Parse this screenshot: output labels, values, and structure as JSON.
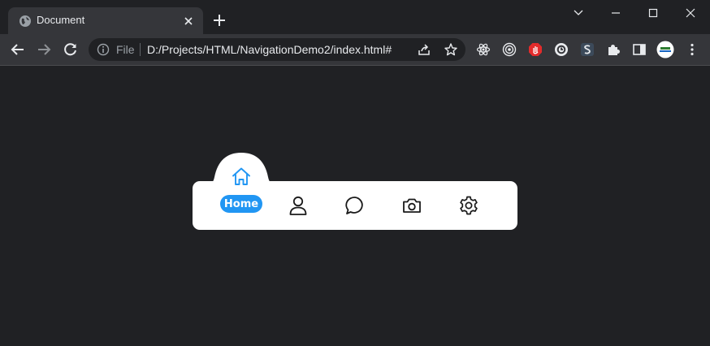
{
  "browser": {
    "tab_title": "Document",
    "omnibox": {
      "scheme_label": "File",
      "url": "D:/Projects/HTML/NavigationDemo2/index.html#"
    }
  },
  "nav": {
    "active_label": "Home",
    "accent_color": "#2196f3",
    "items": [
      {
        "name": "home",
        "icon": "home-icon",
        "active": true
      },
      {
        "name": "profile",
        "icon": "user-icon",
        "active": false
      },
      {
        "name": "messages",
        "icon": "chat-icon",
        "active": false
      },
      {
        "name": "camera",
        "icon": "camera-icon",
        "active": false
      },
      {
        "name": "settings",
        "icon": "gear-icon",
        "active": false
      }
    ]
  }
}
